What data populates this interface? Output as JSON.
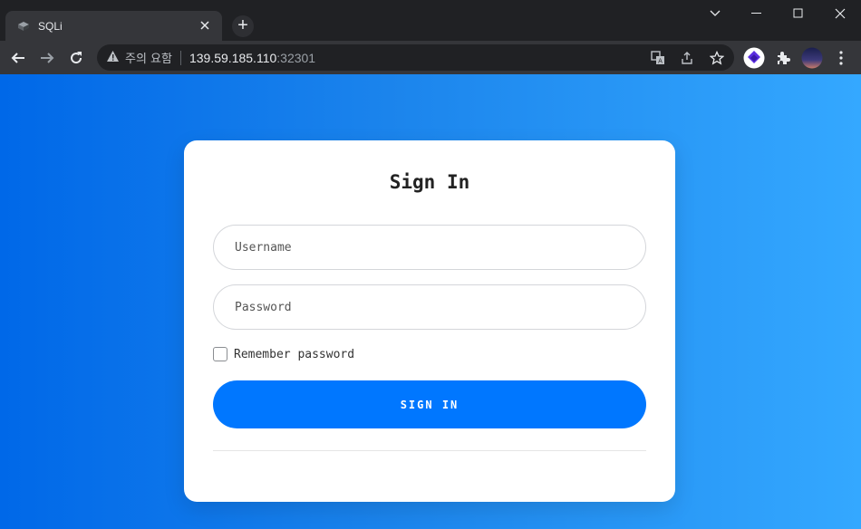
{
  "browser": {
    "tab": {
      "title": "SQLi"
    },
    "new_tab_symbol": "+",
    "address": {
      "security_warning": "주의 요함",
      "host": "139.59.185.110",
      "port": ":32301"
    },
    "icons": [
      "back-icon",
      "forward-icon",
      "reload-icon",
      "warning-icon",
      "translate-icon",
      "share-icon",
      "bookmark-star-icon",
      "extension-icon",
      "puzzle-icon",
      "profile-avatar",
      "menu-icon"
    ]
  },
  "page": {
    "title": "Sign In",
    "username_placeholder": "Username",
    "password_placeholder": "Password",
    "remember_label": "Remember password",
    "submit_label": "SIGN IN",
    "colors": {
      "background_start": "#0068e8",
      "background_end": "#34a8ff",
      "button": "#0077ff"
    }
  }
}
